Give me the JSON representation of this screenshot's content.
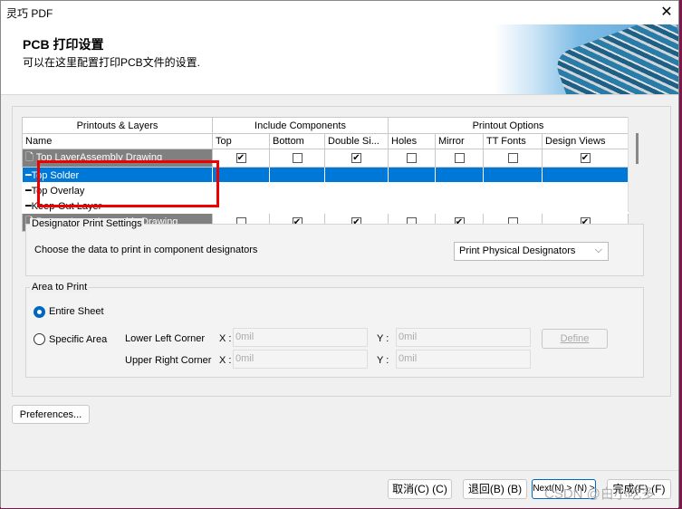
{
  "window": {
    "title": "灵巧 PDF",
    "close_icon": "close-icon"
  },
  "header": {
    "title": "PCB 打印设置",
    "subtitle": "可以在这里配置打印PCB文件的设置."
  },
  "table": {
    "group_headers": [
      "Printouts & Layers",
      "Include Components",
      "Printout Options"
    ],
    "columns": [
      "Name",
      "Top",
      "Bottom",
      "Double Si...",
      "Holes",
      "Mirror",
      "TT Fonts",
      "Design Views"
    ],
    "rows": [
      {
        "name": "Top LayerAssembly Drawing",
        "type": "printout",
        "checks": [
          true,
          false,
          true,
          false,
          false,
          false,
          true
        ]
      },
      {
        "name": "Top Solder",
        "type": "layer",
        "selected": true
      },
      {
        "name": "Top Overlay",
        "type": "layer"
      },
      {
        "name": "Keep-Out Layer",
        "type": "layer"
      },
      {
        "name": "Bottom LayerAssembly Drawing",
        "type": "printout",
        "checks": [
          false,
          true,
          true,
          false,
          true,
          false,
          true
        ]
      }
    ]
  },
  "designator": {
    "legend": "Designator Print Settings",
    "label": "Choose the data to print in component designators",
    "selected": "Print Physical Designators"
  },
  "area": {
    "legend": "Area to Print",
    "entire": "Entire Sheet",
    "specific": "Specific Area",
    "selected": "entire",
    "lower_left": "Lower Left Corner",
    "upper_right": "Upper Right Corner",
    "x": "X :",
    "y": "Y :",
    "ll_x": "0mil",
    "ll_y": "0mil",
    "ur_x": "0mil",
    "ur_y": "0mil",
    "define": "Define"
  },
  "preferences": "Preferences...",
  "footer": {
    "cancel": "取消(C) (C)",
    "back": "退回(B) (B)",
    "next": "Next(N) > (N) >",
    "finish": "完成(F) (F)"
  },
  "watermark": "CSDN @白小吃多"
}
